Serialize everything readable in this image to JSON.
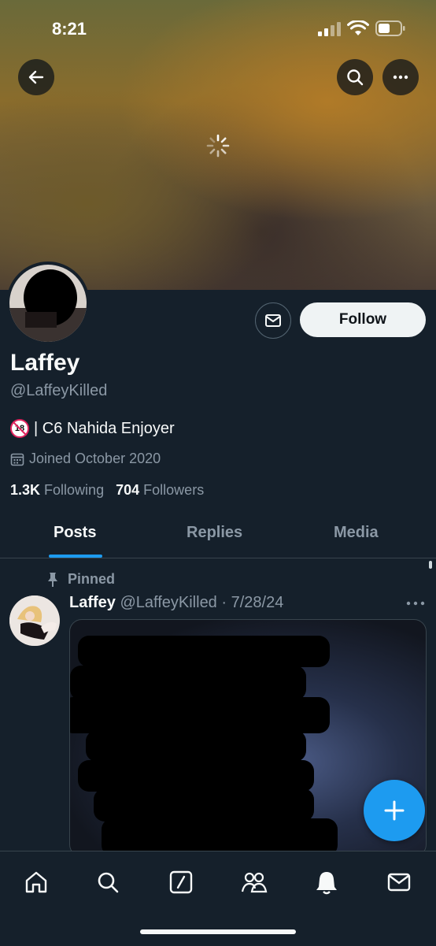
{
  "status_bar": {
    "time": "8:21"
  },
  "header": {
    "back_icon": "arrow-left-icon",
    "search_icon": "search-icon",
    "more_icon": "ellipsis-icon"
  },
  "profile": {
    "name": "Laffey",
    "handle": "@LaffeyKilled",
    "bio_badge": "18",
    "bio": "| C6 Nahida Enjoyer",
    "joined": "Joined October 2020",
    "following_count": "1.3K",
    "following_label": "Following",
    "followers_count": "704",
    "followers_label": "Followers",
    "follow_label": "Follow"
  },
  "tabs": [
    {
      "label": "Posts",
      "active": true
    },
    {
      "label": "Replies",
      "active": false
    },
    {
      "label": "Media",
      "active": false
    }
  ],
  "post": {
    "pinned_label": "Pinned",
    "author": "Laffey",
    "meta": "@LaffeyKilled · 7/28/24"
  },
  "bottom_nav": {
    "items": [
      "home-icon",
      "search-icon",
      "grok-icon",
      "communities-icon",
      "notifications-icon",
      "messages-icon"
    ]
  },
  "colors": {
    "accent": "#1d9bf0",
    "background": "#15202b",
    "muted": "#8b98a5"
  }
}
